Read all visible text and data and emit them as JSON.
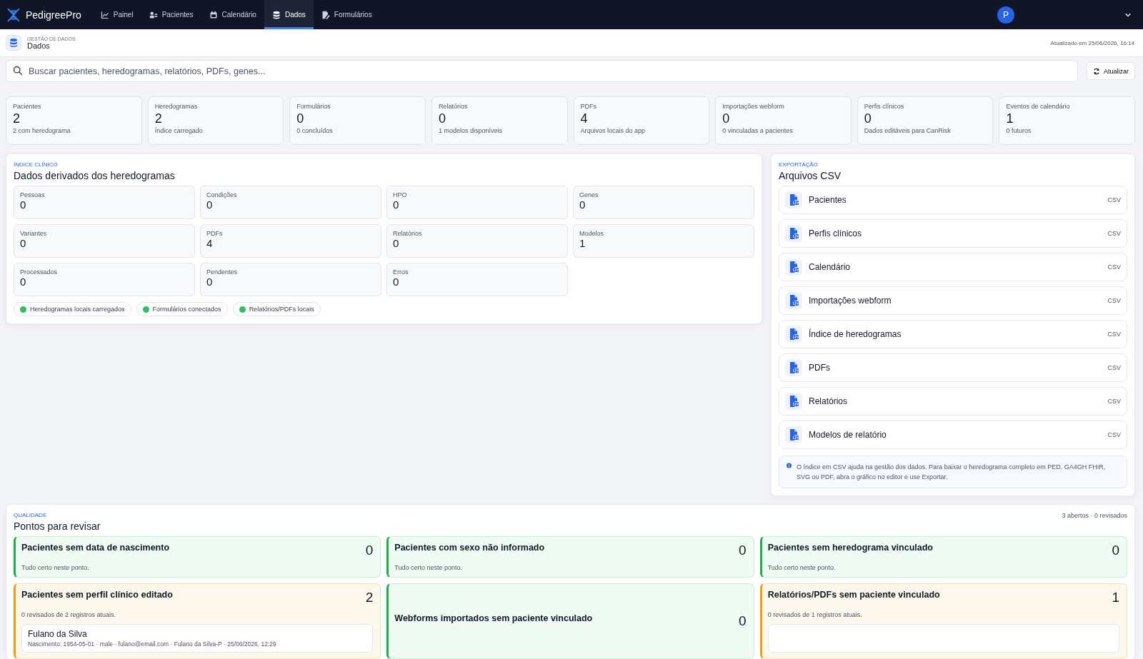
{
  "nav": {
    "brand": "PedigreePro",
    "items": [
      {
        "label": "Painel",
        "kind": "chart",
        "selected": false
      },
      {
        "label": "Pacientes",
        "kind": "people",
        "selected": false
      },
      {
        "label": "Calendário",
        "kind": "calendar",
        "selected": false
      },
      {
        "label": "Dados",
        "kind": "database",
        "selected": true
      },
      {
        "label": "Formulários",
        "kind": "form",
        "selected": false
      }
    ],
    "avatar": "P"
  },
  "header": {
    "eyebrow": "GESTÃO DE DADOS",
    "title": "Dados",
    "updated": "Atualizado em 25/06/2026, 16:14"
  },
  "search": {
    "placeholder": "Buscar pacientes, heredogramas, relatórios, PDFs, genes...",
    "refresh": "Atualizar"
  },
  "stats": [
    {
      "label": "Pacientes",
      "value": "2",
      "sub": "2 com heredograma"
    },
    {
      "label": "Heredogramas",
      "value": "2",
      "sub": "Índice carregado"
    },
    {
      "label": "Formulários",
      "value": "0",
      "sub": "0 concluídos"
    },
    {
      "label": "Relatórios",
      "value": "0",
      "sub": "1 modelos disponíveis"
    },
    {
      "label": "PDFs",
      "value": "4",
      "sub": "Arquivos locais do app"
    },
    {
      "label": "Importações webform",
      "value": "0",
      "sub": "0 vinculadas a pacientes"
    },
    {
      "label": "Perfis clínicos",
      "value": "0",
      "sub": "Dados editáveis para CanRisk"
    },
    {
      "label": "Eventos de calendário",
      "value": "1",
      "sub": "0 futuros"
    }
  ],
  "clinical_index": {
    "eyebrow": "ÍNDICE CLÍNICO",
    "title": "Dados derivados dos heredogramas",
    "metrics": [
      {
        "label": "Pessoas",
        "value": "0"
      },
      {
        "label": "Condições",
        "value": "0"
      },
      {
        "label": "HPO",
        "value": "0"
      },
      {
        "label": "Genes",
        "value": "0"
      },
      {
        "label": "Variantes",
        "value": "0"
      },
      {
        "label": "PDFs",
        "value": "4"
      },
      {
        "label": "Relatórios",
        "value": "0"
      },
      {
        "label": "Modelos",
        "value": "1"
      },
      {
        "label": "Processados",
        "value": "0"
      },
      {
        "label": "Pendentes",
        "value": "0"
      },
      {
        "label": "Erros",
        "value": "0"
      }
    ],
    "statuses": [
      {
        "label": "Heredogramas locais carregados",
        "color": "#22c55e"
      },
      {
        "label": "Formulários conectados",
        "color": "#22c55e"
      },
      {
        "label": "Relatórios/PDFs locais",
        "color": "#22c55e"
      }
    ]
  },
  "export": {
    "eyebrow": "EXPORTAÇÃO",
    "title": "Arquivos CSV",
    "files": [
      {
        "label": "Pacientes",
        "format": "CSV"
      },
      {
        "label": "Perfis clínicos",
        "format": "CSV"
      },
      {
        "label": "Calendário",
        "format": "CSV"
      },
      {
        "label": "Importações webform",
        "format": "CSV"
      },
      {
        "label": "Índice de heredogramas",
        "format": "CSV"
      },
      {
        "label": "PDFs",
        "format": "CSV"
      },
      {
        "label": "Relatórios",
        "format": "CSV"
      },
      {
        "label": "Modelos de relatório",
        "format": "CSV"
      }
    ],
    "note": "O índice em CSV ajuda na gestão dos dados. Para baixar o heredograma completo em PED, GA4GH FHIR, SVG ou PDF, abra o gráfico no editor e use Exportar."
  },
  "quality": {
    "eyebrow": "QUALIDADE",
    "title": "Pontos para revisar",
    "summary": "3 abertos · 0 revisados",
    "checks": [
      {
        "kind": "ok",
        "title": "Pacientes sem data de nascimento",
        "count": "0",
        "note": "Tudo certo neste ponto."
      },
      {
        "kind": "ok",
        "title": "Pacientes com sexo não informado",
        "count": "0",
        "note": "Tudo certo neste ponto."
      },
      {
        "kind": "ok",
        "title": "Pacientes sem heredograma vinculado",
        "count": "0",
        "note": "Tudo certo neste ponto."
      },
      {
        "kind": "warn",
        "title": "Pacientes sem perfil clínico editado",
        "count": "2",
        "note": "0 revisados de 2 registros atuais.",
        "records": [
          {
            "name": "Fulano da Silva",
            "detail": "Nascimento: 1954-05-01 · male · fulano@email.com · Fulano da Silva-P · 25/06/2026, 12:29"
          }
        ]
      },
      {
        "kind": "ok",
        "title": "Webforms importados sem paciente vinculado",
        "count": "0"
      },
      {
        "kind": "warn",
        "title": "Relatórios/PDFs sem paciente vinculado",
        "count": "1",
        "note": "0 revisados de 1 registros atuais.",
        "record_preview": true
      }
    ]
  }
}
